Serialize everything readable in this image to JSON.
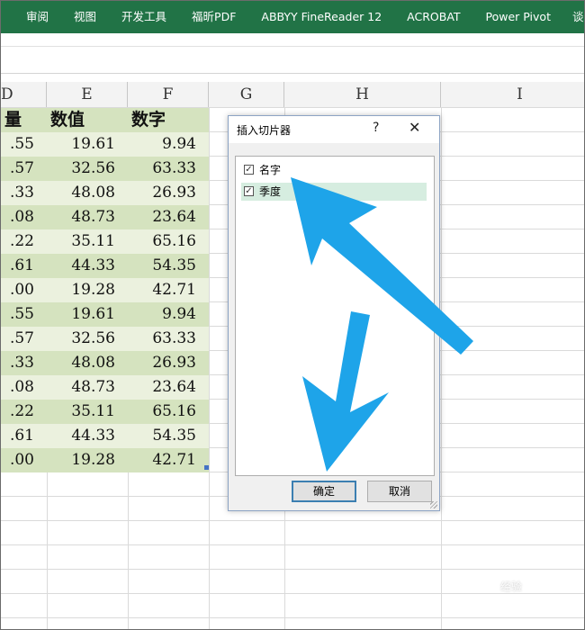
{
  "ribbon": {
    "tabs": [
      "审阅",
      "视图",
      "开发工具",
      "福昕PDF",
      "ABBYY FineReader 12",
      "ACROBAT",
      "Power Pivot",
      "谈"
    ]
  },
  "columns": [
    "D",
    "E",
    "F",
    "G",
    "H",
    "I"
  ],
  "table": {
    "headers": [
      "量",
      "数值",
      "数字"
    ],
    "rows": [
      [
        ".55",
        "19.61",
        "9.94"
      ],
      [
        ".57",
        "32.56",
        "63.33"
      ],
      [
        ".33",
        "48.08",
        "26.93"
      ],
      [
        ".08",
        "48.73",
        "23.64"
      ],
      [
        ".22",
        "35.11",
        "65.16"
      ],
      [
        ".61",
        "44.33",
        "54.35"
      ],
      [
        ".00",
        "19.28",
        "42.71"
      ],
      [
        ".55",
        "19.61",
        "9.94"
      ],
      [
        ".57",
        "32.56",
        "63.33"
      ],
      [
        ".33",
        "48.08",
        "26.93"
      ],
      [
        ".08",
        "48.73",
        "23.64"
      ],
      [
        ".22",
        "35.11",
        "65.16"
      ],
      [
        ".61",
        "44.33",
        "54.35"
      ],
      [
        ".00",
        "19.28",
        "42.71"
      ]
    ]
  },
  "dialog": {
    "title": "插入切片器",
    "help": "?",
    "close": "✕",
    "fields": [
      {
        "label": "名字",
        "checked": true
      },
      {
        "label": "季度",
        "checked": true
      }
    ],
    "ok_label": "确定",
    "cancel_label": "取消"
  },
  "colors": {
    "ribbon": "#217346",
    "band_dark": "#d5e3bf",
    "band_light": "#ebf1de",
    "arrow": "#1ea4e9"
  },
  "watermark": "经验"
}
